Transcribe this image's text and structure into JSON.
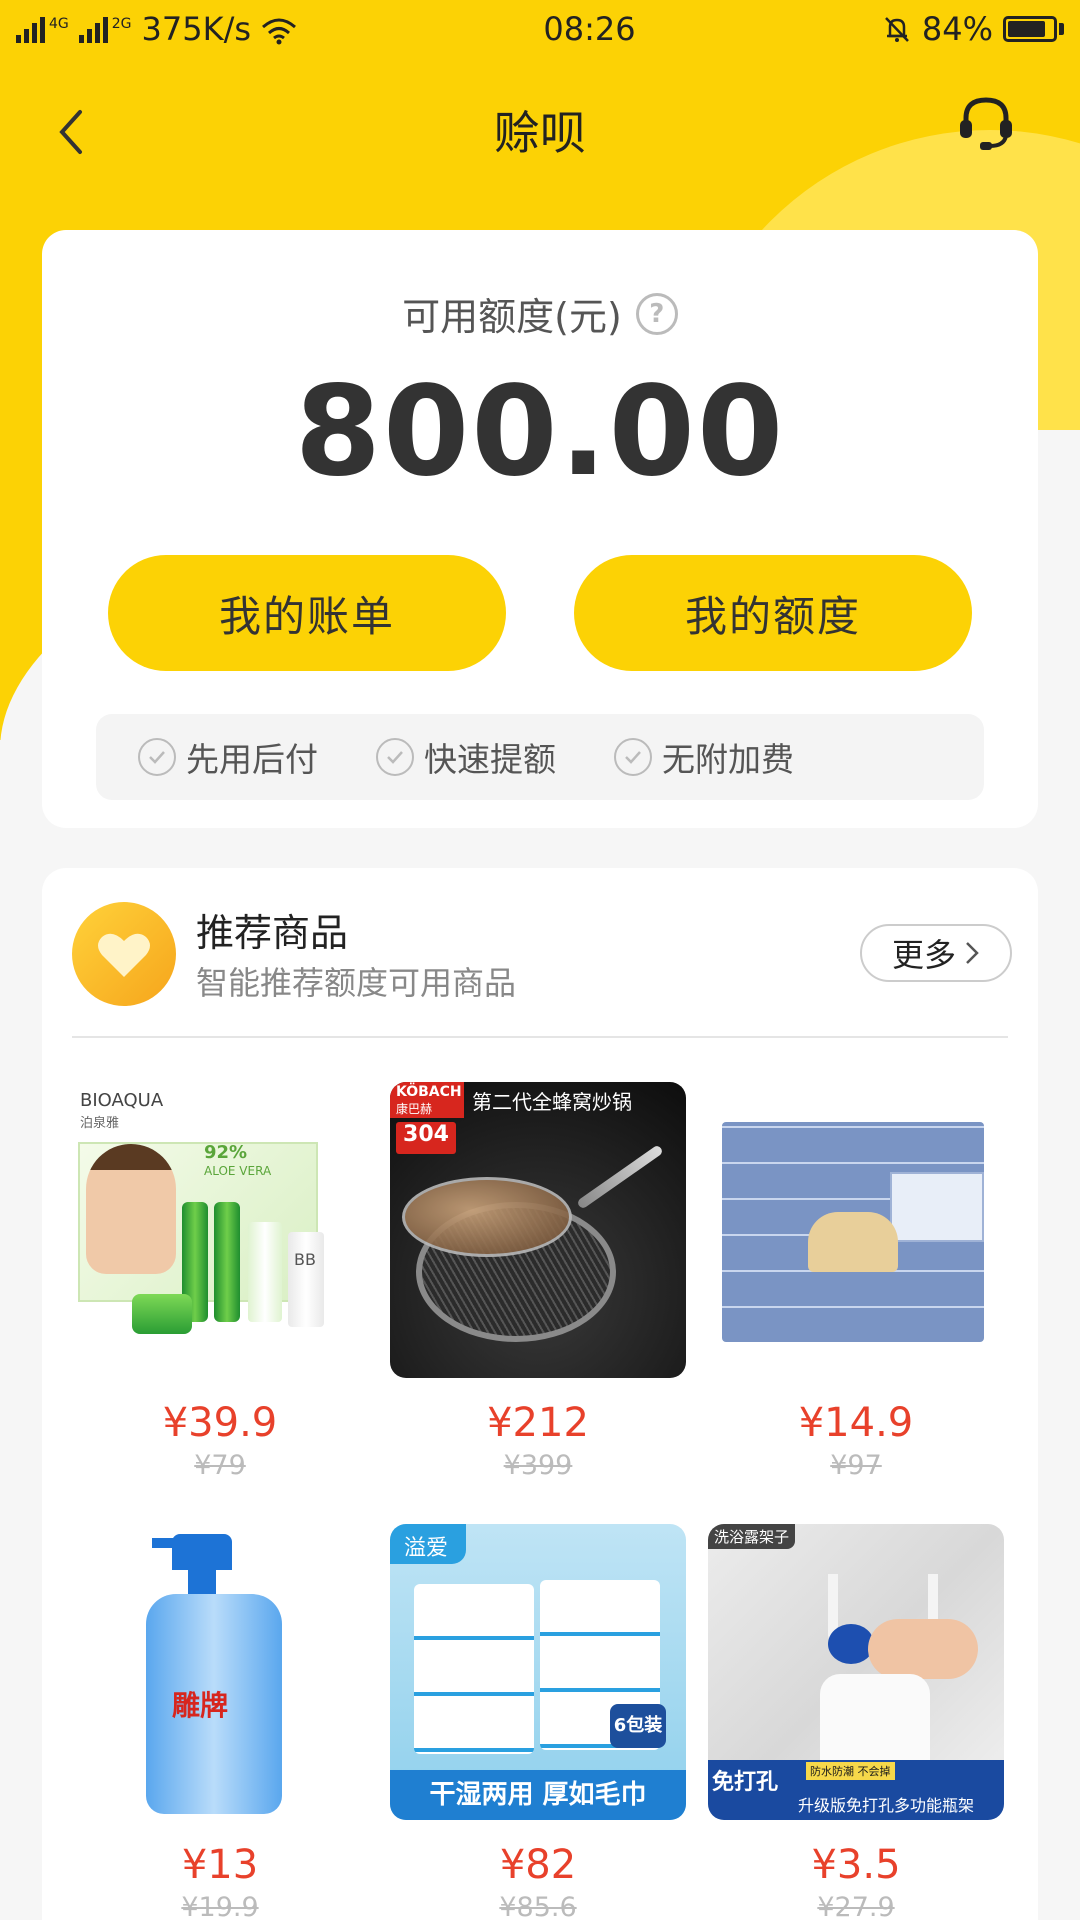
{
  "status_bar": {
    "network_1": "4G",
    "network_2": "2G",
    "speed": "375K/s",
    "time": "08:26",
    "battery_text": "84%",
    "battery_level": 0.84
  },
  "nav": {
    "title": "赊呗",
    "back_icon": "chevron-left-icon",
    "service_icon": "headset-icon"
  },
  "credit": {
    "label": "可用额度(元)",
    "help_icon": "question-icon",
    "amount": "800.00",
    "bill_button": "我的账单",
    "quota_button": "我的额度",
    "features": [
      "先用后付",
      "快速提额",
      "无附加费"
    ]
  },
  "recommend": {
    "title": "推荐商品",
    "subtitle": "智能推荐额度可用商品",
    "more_label": "更多",
    "products": [
      {
        "price": "¥39.9",
        "old_price": "¥79",
        "image_text": [
          "BIOAQUA",
          "泊泉雅",
          "92%",
          "ALOE VERA",
          "BB"
        ]
      },
      {
        "price": "¥212",
        "old_price": "¥399",
        "image_text": [
          "KÖBACH",
          "康巴赫",
          "304",
          "第二代全蜂窝炒锅"
        ]
      },
      {
        "price": "¥14.9",
        "old_price": "¥97",
        "image_text": []
      },
      {
        "price": "¥13",
        "old_price": "¥19.9",
        "image_text": [
          "雕牌"
        ]
      },
      {
        "price": "¥82",
        "old_price": "¥85.6",
        "image_text": [
          "溢爱",
          "6包装",
          "干湿两用 厚如毛巾"
        ]
      },
      {
        "price": "¥3.5",
        "old_price": "¥27.9",
        "image_text": [
          "洗浴露架子",
          "免打孔",
          "防水防潮 不会掉",
          "升级版免打孔多功能瓶架"
        ]
      }
    ]
  },
  "colors": {
    "brand_yellow": "#FCD205",
    "price_red": "#E8412B"
  }
}
